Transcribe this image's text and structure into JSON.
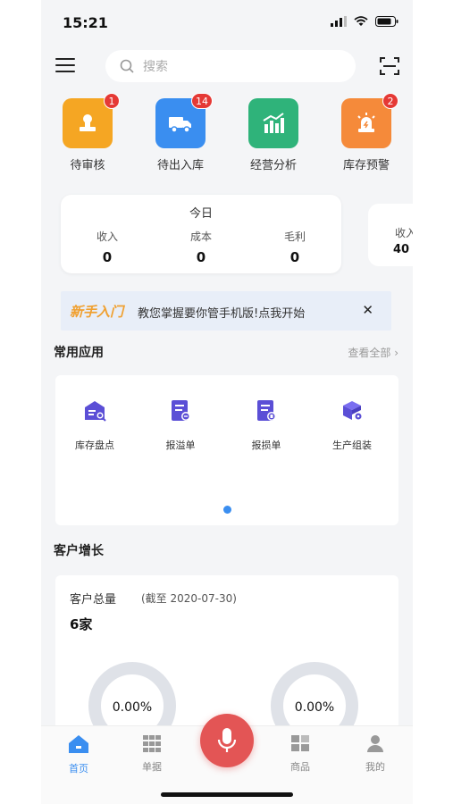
{
  "status": {
    "time": "15:21"
  },
  "search": {
    "placeholder": "搜索"
  },
  "quick_actions": [
    {
      "label": "待审核",
      "badge": "1",
      "color": "#f5a623",
      "icon": "stamp-icon"
    },
    {
      "label": "待出入库",
      "badge": "14",
      "color": "#3a8ef0",
      "icon": "truck-icon"
    },
    {
      "label": "经营分析",
      "badge": "",
      "color": "#2fb37a",
      "icon": "bar-chart-icon"
    },
    {
      "label": "库存预警",
      "badge": "2",
      "color": "#f58a3a",
      "icon": "alarm-icon"
    }
  ],
  "today": {
    "title": "今日",
    "income_label": "收入",
    "income_value": "0",
    "cost_label": "成本",
    "cost_value": "0",
    "profit_label": "毛利",
    "profit_value": "0"
  },
  "next_card": {
    "label": "收入",
    "value": "40"
  },
  "banner": {
    "tag": "新手入门",
    "text": "教您掌握要你管手机版!点我开始",
    "close": "✕"
  },
  "common_apps": {
    "title": "常用应用",
    "view_all": "查看全部 ›",
    "items": [
      {
        "label": "库存盘点",
        "icon": "inventory-check-icon"
      },
      {
        "label": "报溢单",
        "icon": "overflow-report-icon"
      },
      {
        "label": "报损单",
        "icon": "loss-report-icon"
      },
      {
        "label": "生产组装",
        "icon": "assembly-icon"
      }
    ]
  },
  "customer_growth": {
    "title": "客户增长",
    "total_label": "客户总量",
    "as_of": "(截至 2020-07-30)",
    "total_value": "6家",
    "ring1": "0.00%",
    "ring2": "0.00%"
  },
  "tabbar": {
    "home": "首页",
    "documents": "单据",
    "products": "商品",
    "me": "我的"
  },
  "colors": {
    "accent": "#3a8ef0",
    "mic": "#e35555",
    "purple": "#5b4fd6"
  }
}
